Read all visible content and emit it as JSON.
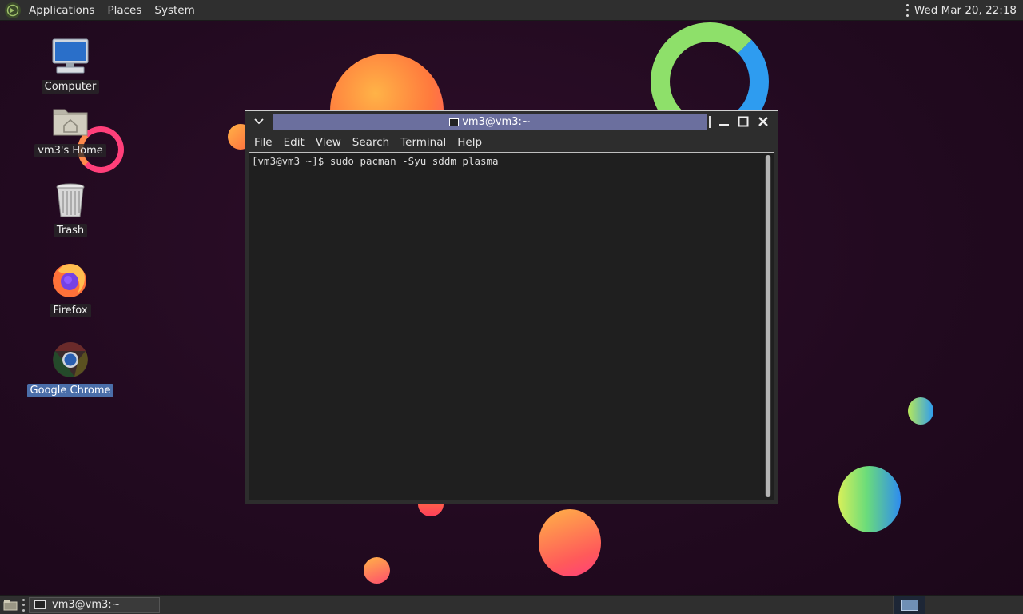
{
  "top_panel": {
    "menus": [
      "Applications",
      "Places",
      "System"
    ],
    "clock": "Wed Mar 20, 22:18"
  },
  "desktop": {
    "icons": [
      {
        "label": "Computer",
        "icon": "computer-icon"
      },
      {
        "label": "vm3's Home",
        "icon": "home-folder-icon"
      },
      {
        "label": "Trash",
        "icon": "trash-icon"
      },
      {
        "label": "Firefox",
        "icon": "firefox-icon"
      },
      {
        "label": "Google Chrome",
        "icon": "chrome-icon",
        "selected": true
      }
    ]
  },
  "terminal": {
    "title": "vm3@vm3:~",
    "menus": [
      "File",
      "Edit",
      "View",
      "Search",
      "Terminal",
      "Help"
    ],
    "content": "[vm3@vm3 ~]$ sudo pacman -Syu sddm plasma"
  },
  "taskbar": {
    "tasks": [
      "vm3@vm3:~"
    ]
  },
  "colors": {
    "title_active": "#6b6f9e",
    "workspace_active": "#1d2636",
    "background": "#220a20"
  }
}
